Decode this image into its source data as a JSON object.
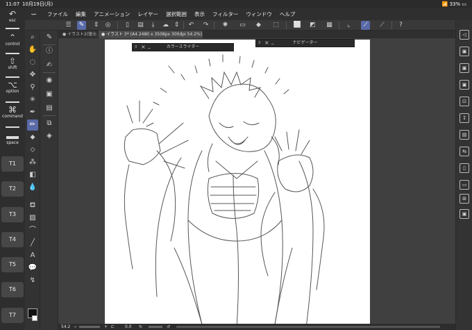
{
  "status": {
    "time": "11:07",
    "date": "10月19日(月)",
    "battery": "33%"
  },
  "modifier_keys": [
    {
      "symbol": "↶",
      "label": "esc"
    },
    {
      "symbol": "⌃",
      "label": "control"
    },
    {
      "symbol": "⇧",
      "label": "shift"
    },
    {
      "symbol": "⌥",
      "label": "option"
    },
    {
      "symbol": "⌘",
      "label": "command"
    },
    {
      "symbol": "",
      "label": "space"
    }
  ],
  "tkeys": [
    "T1",
    "T2",
    "T3",
    "T4",
    "T5",
    "T6",
    "T7"
  ],
  "menubar": {
    "items": [
      "ファイル",
      "編集",
      "アニメーション",
      "レイヤー",
      "選択範囲",
      "表示",
      "フィルター",
      "ウィンドウ",
      "ヘルプ"
    ]
  },
  "tabs": [
    {
      "label": "● イラスト2(復元",
      "active": false
    },
    {
      "label": "● イラスト 3* (A4 2480 x 3508px 300dpi 54.2%)",
      "active": true
    }
  ],
  "panels": {
    "color_slider": "カラースライダー",
    "navigator": "ナビゲーター"
  },
  "bottom": {
    "zoom": "54.2",
    "angle": "0.0"
  },
  "colors": {
    "accent": "#5a6aa8",
    "main_color": "#111111",
    "sub_color": "#ffffff"
  }
}
